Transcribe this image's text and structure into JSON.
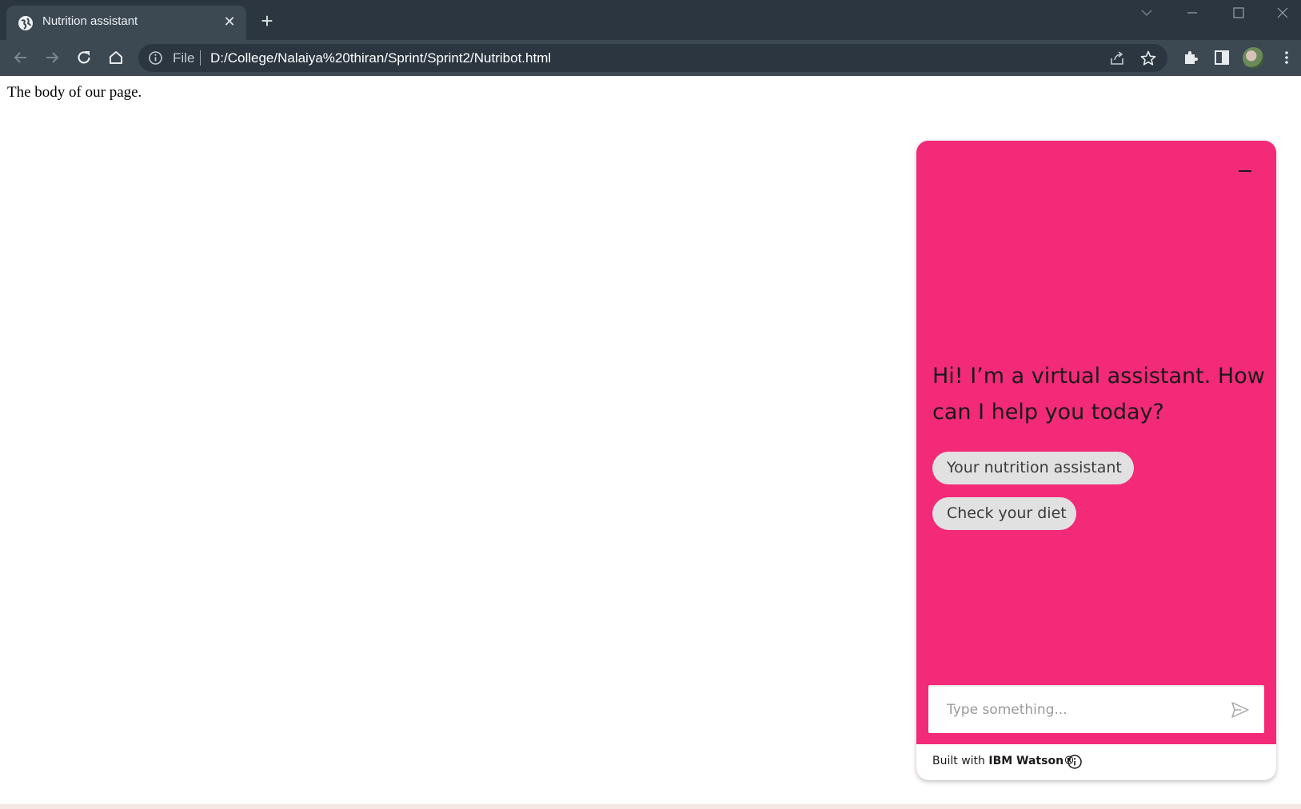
{
  "browser": {
    "tab": {
      "title": "Nutrition assistant",
      "close_label": "✕",
      "favicon": "globe-icon"
    },
    "new_tab_label": "+",
    "window_controls": [
      "chevron-down-icon",
      "minimize-icon",
      "maximize-icon",
      "close-icon"
    ],
    "toolbar": {
      "back": "back-arrow-icon",
      "forward": "forward-arrow-icon",
      "reload": "reload-icon",
      "home": "home-icon"
    },
    "omnibox": {
      "scheme_label": "File",
      "url": "D:/College/Nalaiya%20thiran/Sprint/Sprint2/Nutribot.html"
    },
    "colors": {
      "tabstrip": "#2b3640",
      "toolbar": "#3c4852"
    }
  },
  "page": {
    "body_text": "The body of our page."
  },
  "chat": {
    "accent_color": "#f22a78",
    "greeting": "Hi! I’m a virtual assistant. How can I help you today?",
    "options": [
      {
        "label": "Your nutrition assistant"
      },
      {
        "label": "Check your diet"
      }
    ],
    "input": {
      "placeholder": "Type something...",
      "value": ""
    },
    "footer": {
      "prefix": "Built with ",
      "brand": "IBM Watson®"
    }
  }
}
